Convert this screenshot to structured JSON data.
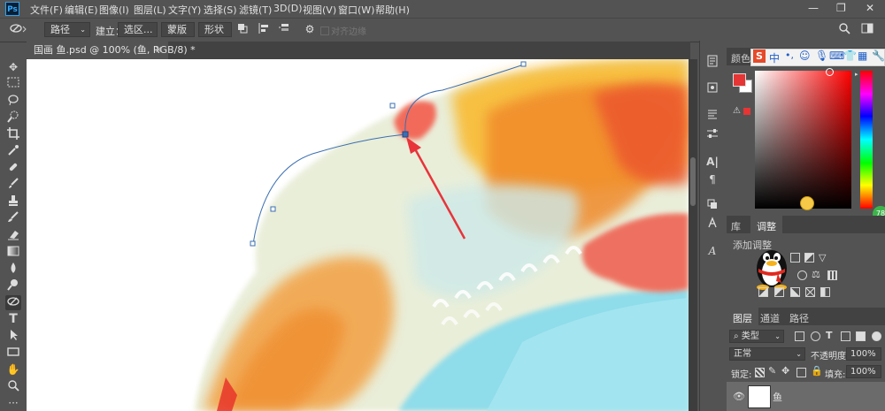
{
  "app": {
    "logo": "Ps"
  },
  "menu": [
    "文件(F)",
    "编辑(E)",
    "图像(I)",
    "图层(L)",
    "文字(Y)",
    "选择(S)",
    "滤镜(T)",
    "3D(D)",
    "视图(V)",
    "窗口(W)",
    "帮助(H)"
  ],
  "window_controls": {
    "minimize": "—",
    "restore": "❐",
    "close": "✕"
  },
  "options": {
    "mode": "路径",
    "create_label": "建立：",
    "selection_btn": "选区...",
    "mask_btn": "蒙版",
    "shape_btn": "形状",
    "align_edges": "对齐边缘"
  },
  "document": {
    "tab_title": "国画 鱼.psd @ 100% (鱼, RGB/8) *"
  },
  "panels": {
    "color_tab": "颜色",
    "library_tab": "库",
    "adjust_tab": "调整",
    "add_adjustment": "添加调整",
    "layers_tab": "图层",
    "channels_tab": "通道",
    "paths_tab": "路径",
    "filter_kind": "类型",
    "blend_mode": "正常",
    "opacity_label": "不透明度:",
    "opacity_value": "100%",
    "lock_label": "锁定:",
    "fill_label": "填充:",
    "fill_value": "100%",
    "layer_name": "鱼",
    "badge": "78"
  },
  "ime": {
    "s": "S",
    "zh": "中"
  },
  "colors": {
    "foreground": "#e53535",
    "accent": "#2ea3f2",
    "path_stroke": "#3b6fb0"
  }
}
